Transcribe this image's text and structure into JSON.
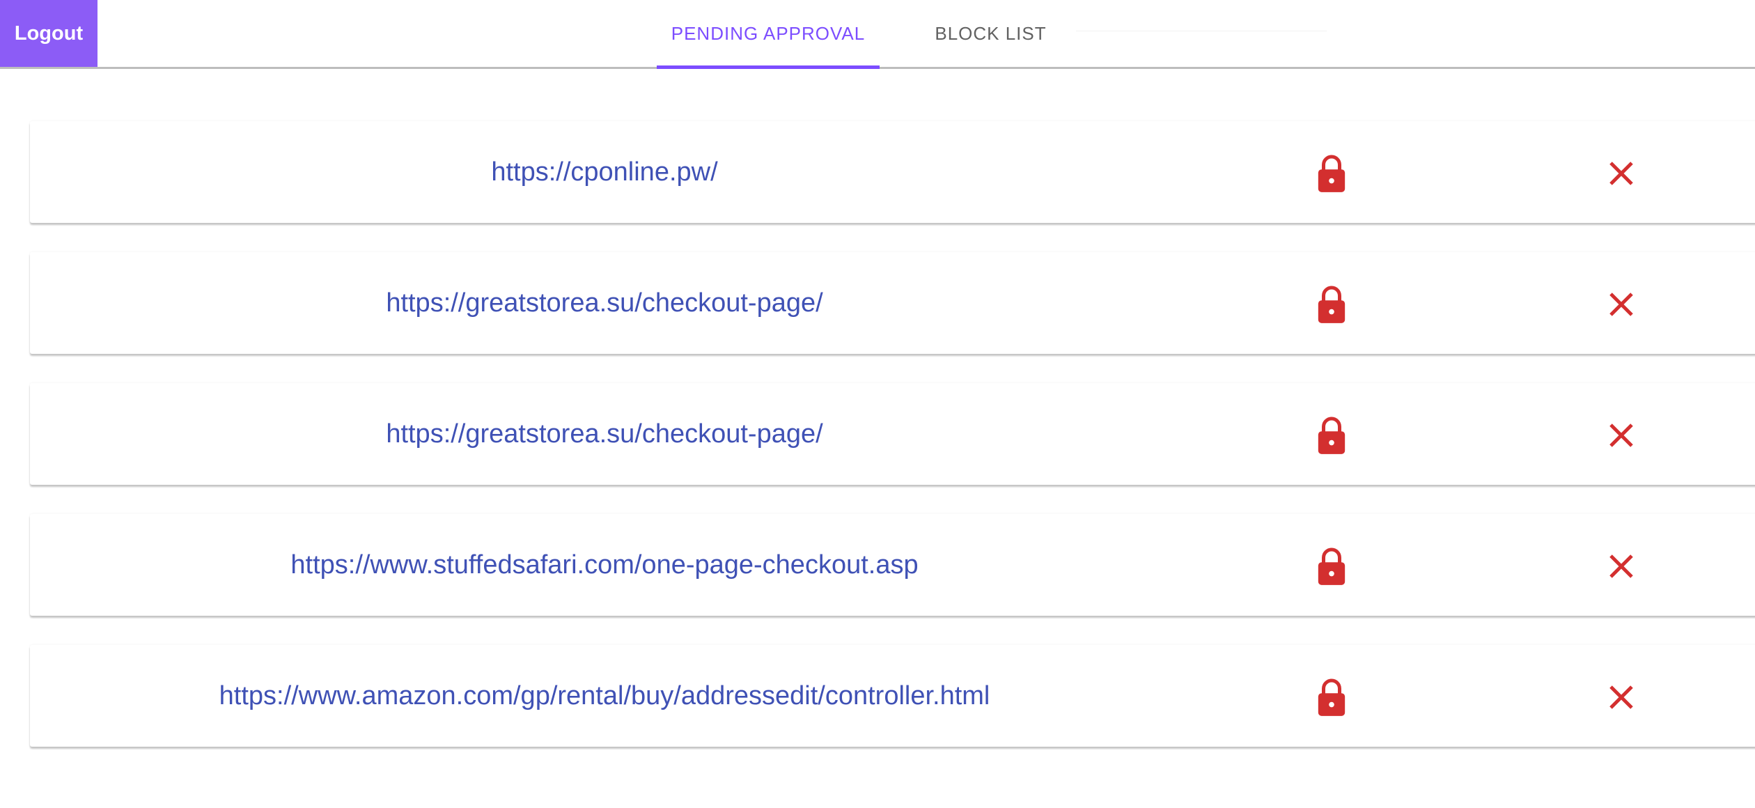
{
  "header": {
    "logout_label": "Logout",
    "tabs": [
      {
        "label": "PENDING APPROVAL",
        "active": true
      },
      {
        "label": "BLOCK LIST",
        "active": false
      }
    ]
  },
  "colors": {
    "logout_bg": "#8c5cf6",
    "active_tab": "#7c4dff",
    "url_text": "#3f51b5",
    "action_red": "#d32f2f"
  },
  "pending_list": [
    {
      "url": "https://cponline.pw/",
      "block_icon": "lock-icon",
      "remove_icon": "close-icon"
    },
    {
      "url": "https://greatstorea.su/checkout-page/",
      "block_icon": "lock-icon",
      "remove_icon": "close-icon"
    },
    {
      "url": "https://greatstorea.su/checkout-page/",
      "block_icon": "lock-icon",
      "remove_icon": "close-icon"
    },
    {
      "url": "https://www.stuffedsafari.com/one-page-checkout.asp",
      "block_icon": "lock-icon",
      "remove_icon": "close-icon"
    },
    {
      "url": "https://www.amazon.com/gp/rental/buy/addressedit/controller.html",
      "block_icon": "lock-icon",
      "remove_icon": "close-icon"
    }
  ]
}
